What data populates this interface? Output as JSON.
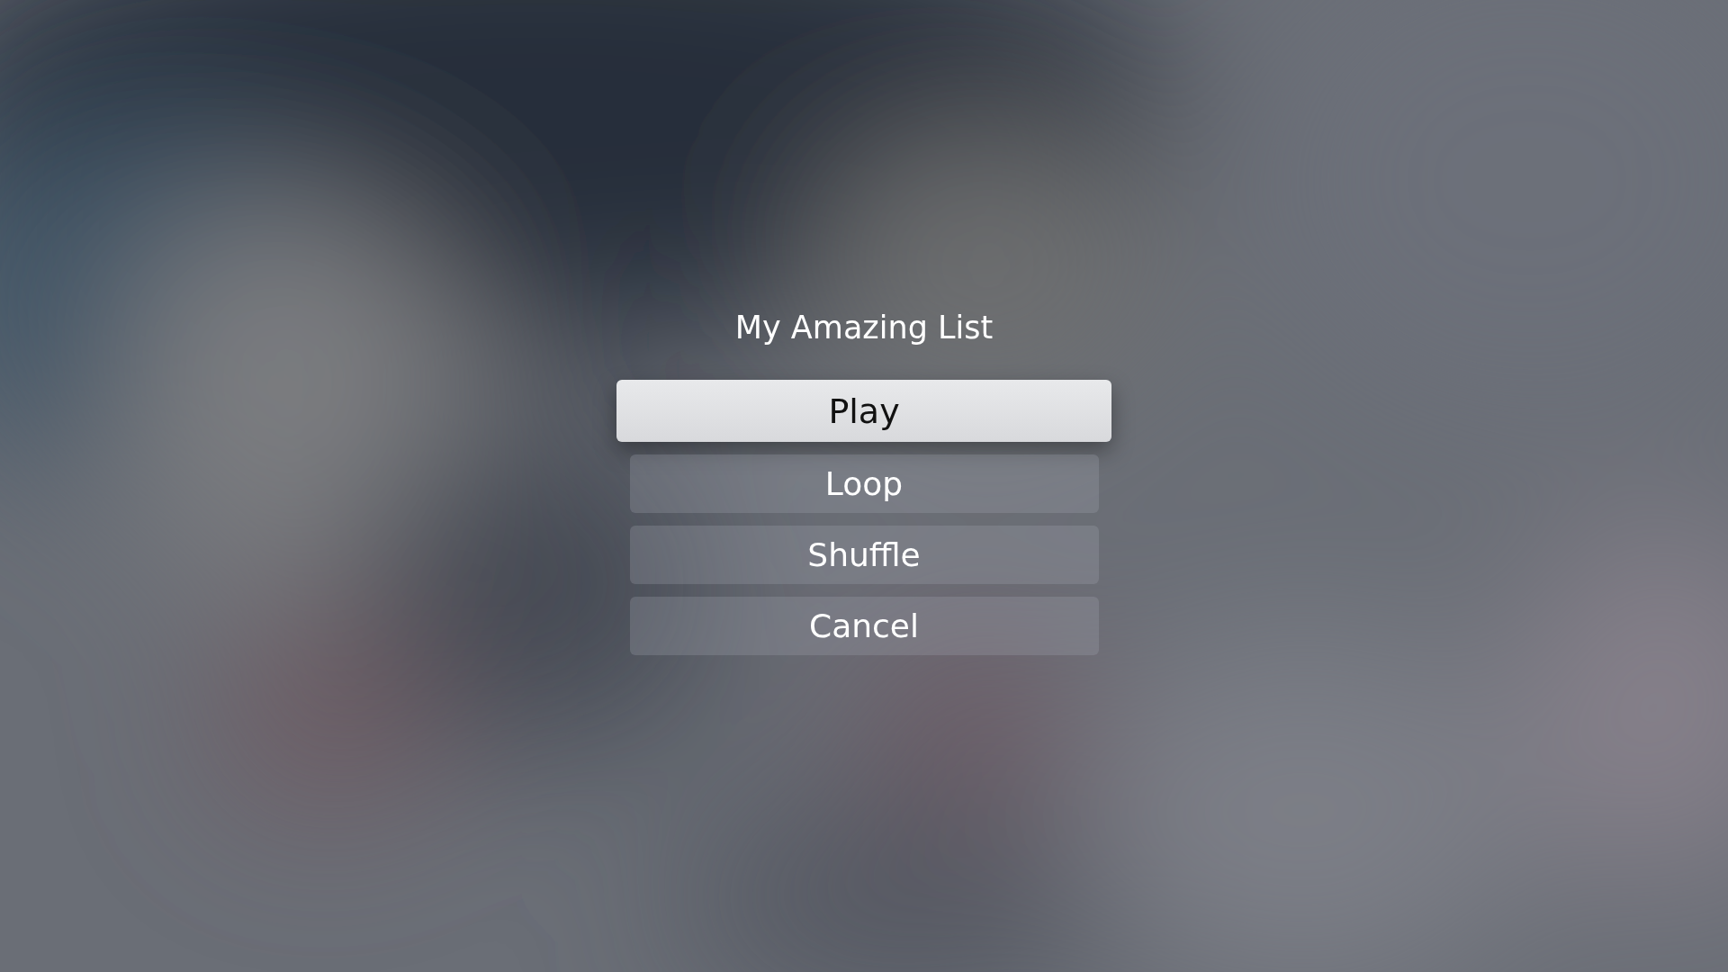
{
  "title": "My Amazing List",
  "actions": [
    {
      "label": "Play",
      "selected": true
    },
    {
      "label": "Loop",
      "selected": false
    },
    {
      "label": "Shuffle",
      "selected": false
    },
    {
      "label": "Cancel",
      "selected": false
    }
  ]
}
